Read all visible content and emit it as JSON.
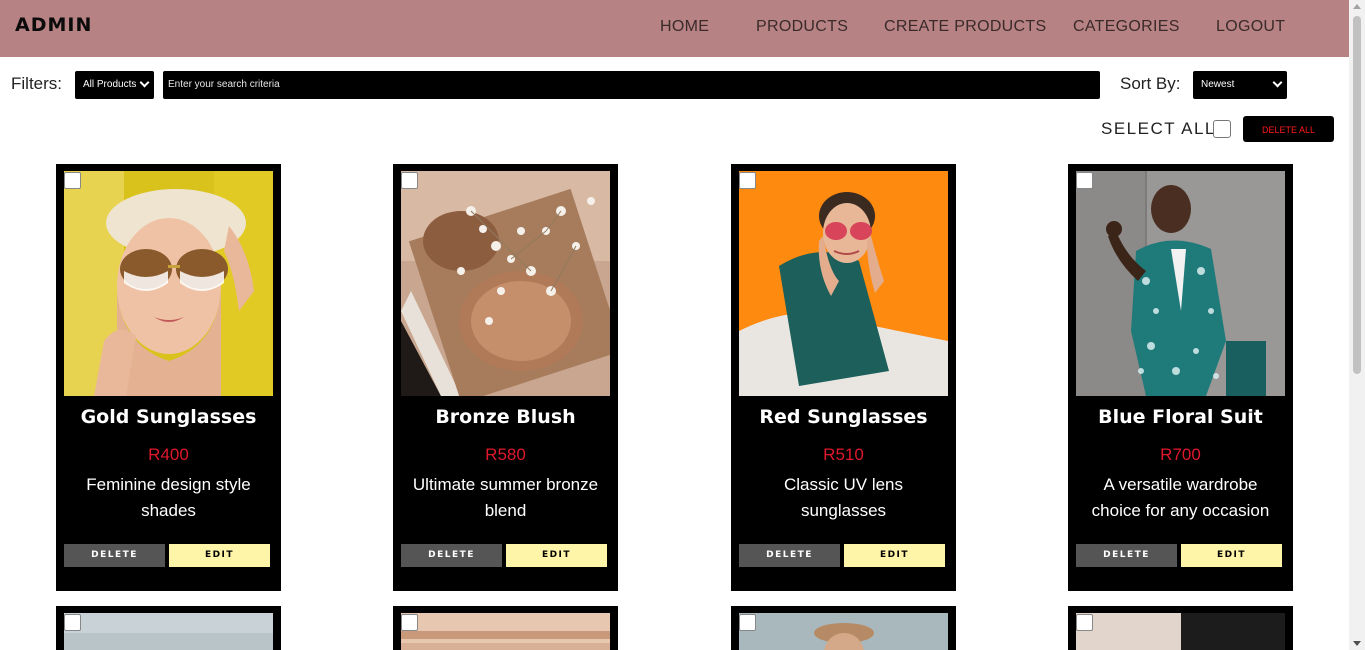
{
  "header": {
    "brand": "ADMIN",
    "nav": [
      "HOME",
      "PRODUCTS",
      "CREATE PRODUCTS",
      "CATEGORIES",
      "LOGOUT"
    ],
    "background_color": "#b78283"
  },
  "filters": {
    "label": "Filters:",
    "category_selected": "All Products",
    "search_placeholder": "Enter your search criteria",
    "sort_label": "Sort By:",
    "sort_selected": "Newest"
  },
  "bulk": {
    "select_all_label": "SELECT ALL",
    "delete_all_label": "DELETE ALL"
  },
  "products": [
    {
      "title": "Gold Sunglasses",
      "price": "R400",
      "description": "Feminine design style shades",
      "delete_label": "DELETE",
      "edit_label": "EDIT"
    },
    {
      "title": "Bronze Blush",
      "price": "R580",
      "description": "Ultimate summer bronze blend",
      "delete_label": "DELETE",
      "edit_label": "EDIT"
    },
    {
      "title": "Red Sunglasses",
      "price": "R510",
      "description": "Classic UV lens sunglasses",
      "delete_label": "DELETE",
      "edit_label": "EDIT"
    },
    {
      "title": "Blue Floral Suit",
      "price": "R700",
      "description": "A versatile wardrobe choice for any occasion",
      "delete_label": "DELETE",
      "edit_label": "EDIT"
    }
  ],
  "colors": {
    "price": "#e0182d",
    "edit_button": "#fff5a8",
    "delete_button": "#555555",
    "delete_all_text": "#ff1a1a"
  }
}
